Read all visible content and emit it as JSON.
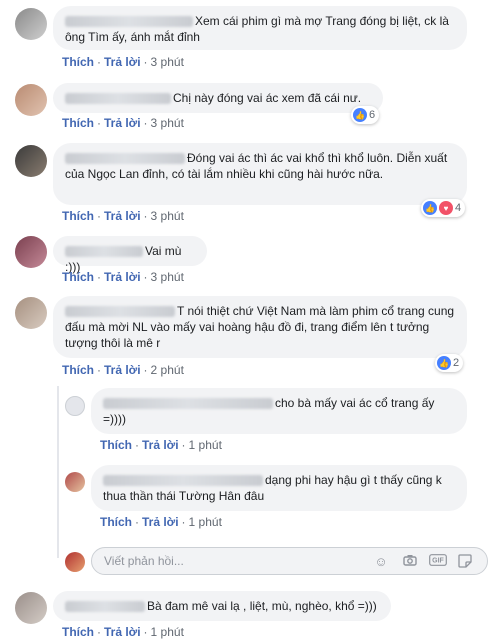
{
  "comments": [
    {
      "text": "Xem cái phim gì mà mợ Trang đóng bị liệt, ck là ông Tìm ấy, ánh mắt đỉnh",
      "like": "Thích",
      "reply": "Trả lời",
      "time": "3 phút"
    },
    {
      "text": "Chị này đóng vai ác xem đã cái nư.",
      "like": "Thích",
      "reply": "Trả lời",
      "time": "3 phút",
      "reactions": "6"
    },
    {
      "text": "Đóng vai ác thì ác vai khổ thì khổ luôn. Diễn xuất của Ngọc Lan đỉnh, có tài lắm nhiều khi cũng hài hước nữa.",
      "like": "Thích",
      "reply": "Trả lời",
      "time": "3 phút",
      "reactions": "4"
    },
    {
      "text": "Vai mù :)))",
      "like": "Thích",
      "reply": "Trả lời",
      "time": "3 phút"
    },
    {
      "text": "T nói thiệt chứ Việt Nam mà làm phim cổ trang cung đấu mà mời NL vào mấy vai hoàng hậu đồ đi, trang điểm lên t tưởng tượng thôi là mê r",
      "like": "Thích",
      "reply": "Trả lời",
      "time": "2 phút",
      "reactions": "2"
    },
    {
      "text": "cho bà mấy vai ác cổ trang ấy =))))",
      "like": "Thích",
      "reply": "Trả lời",
      "time": "1 phút"
    },
    {
      "text": "dạng phi hay hậu gì t thấy cũng k thua thần thái Tường Hân đâu",
      "like": "Thích",
      "reply": "Trả lời",
      "time": "1 phút"
    },
    {
      "text": "Bà đam mê vai lạ , liệt, mù, nghèo, khổ =)))",
      "like": "Thích",
      "reply": "Trả lời",
      "time": "1 phút"
    }
  ],
  "reply_input": {
    "placeholder": "Viết phản hồi..."
  },
  "icons": [
    "like-icon",
    "love-icon",
    "emoji-icon",
    "camera-icon",
    "gif-icon",
    "sticker-icon"
  ],
  "colors": {
    "link": "#4267b2",
    "bubble": "#f2f3f5",
    "like": "#4680ff",
    "love": "#f25268"
  }
}
